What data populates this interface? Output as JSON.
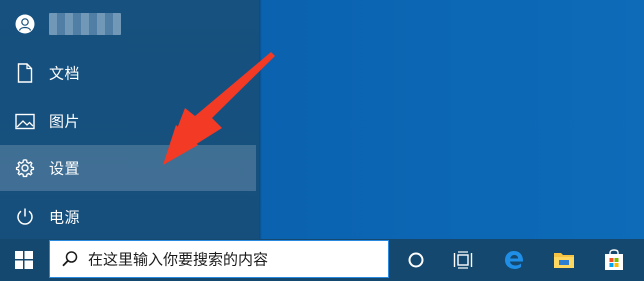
{
  "start_menu": {
    "user": {
      "name_blurred": true
    },
    "items": [
      {
        "label": "文档",
        "icon": "document-icon"
      },
      {
        "label": "图片",
        "icon": "pictures-icon"
      },
      {
        "label": "设置",
        "icon": "gear-icon"
      },
      {
        "label": "电源",
        "icon": "power-icon"
      }
    ],
    "highlighted_item": "设置"
  },
  "annotation": {
    "type": "red-arrow",
    "color": "#f23a25",
    "points_to": "设置"
  },
  "taskbar": {
    "search": {
      "placeholder": "在这里输入你要搜索的内容"
    },
    "icons": [
      "windows-start-icon",
      "cortana-icon",
      "task-view-icon",
      "edge-icon",
      "file-explorer-icon",
      "store-icon"
    ]
  },
  "colors": {
    "desktop": "#0b63b0",
    "start_panel": "#16517f",
    "taskbar": "#15486e",
    "highlight": "rgba(255,255,255,0.18)"
  }
}
